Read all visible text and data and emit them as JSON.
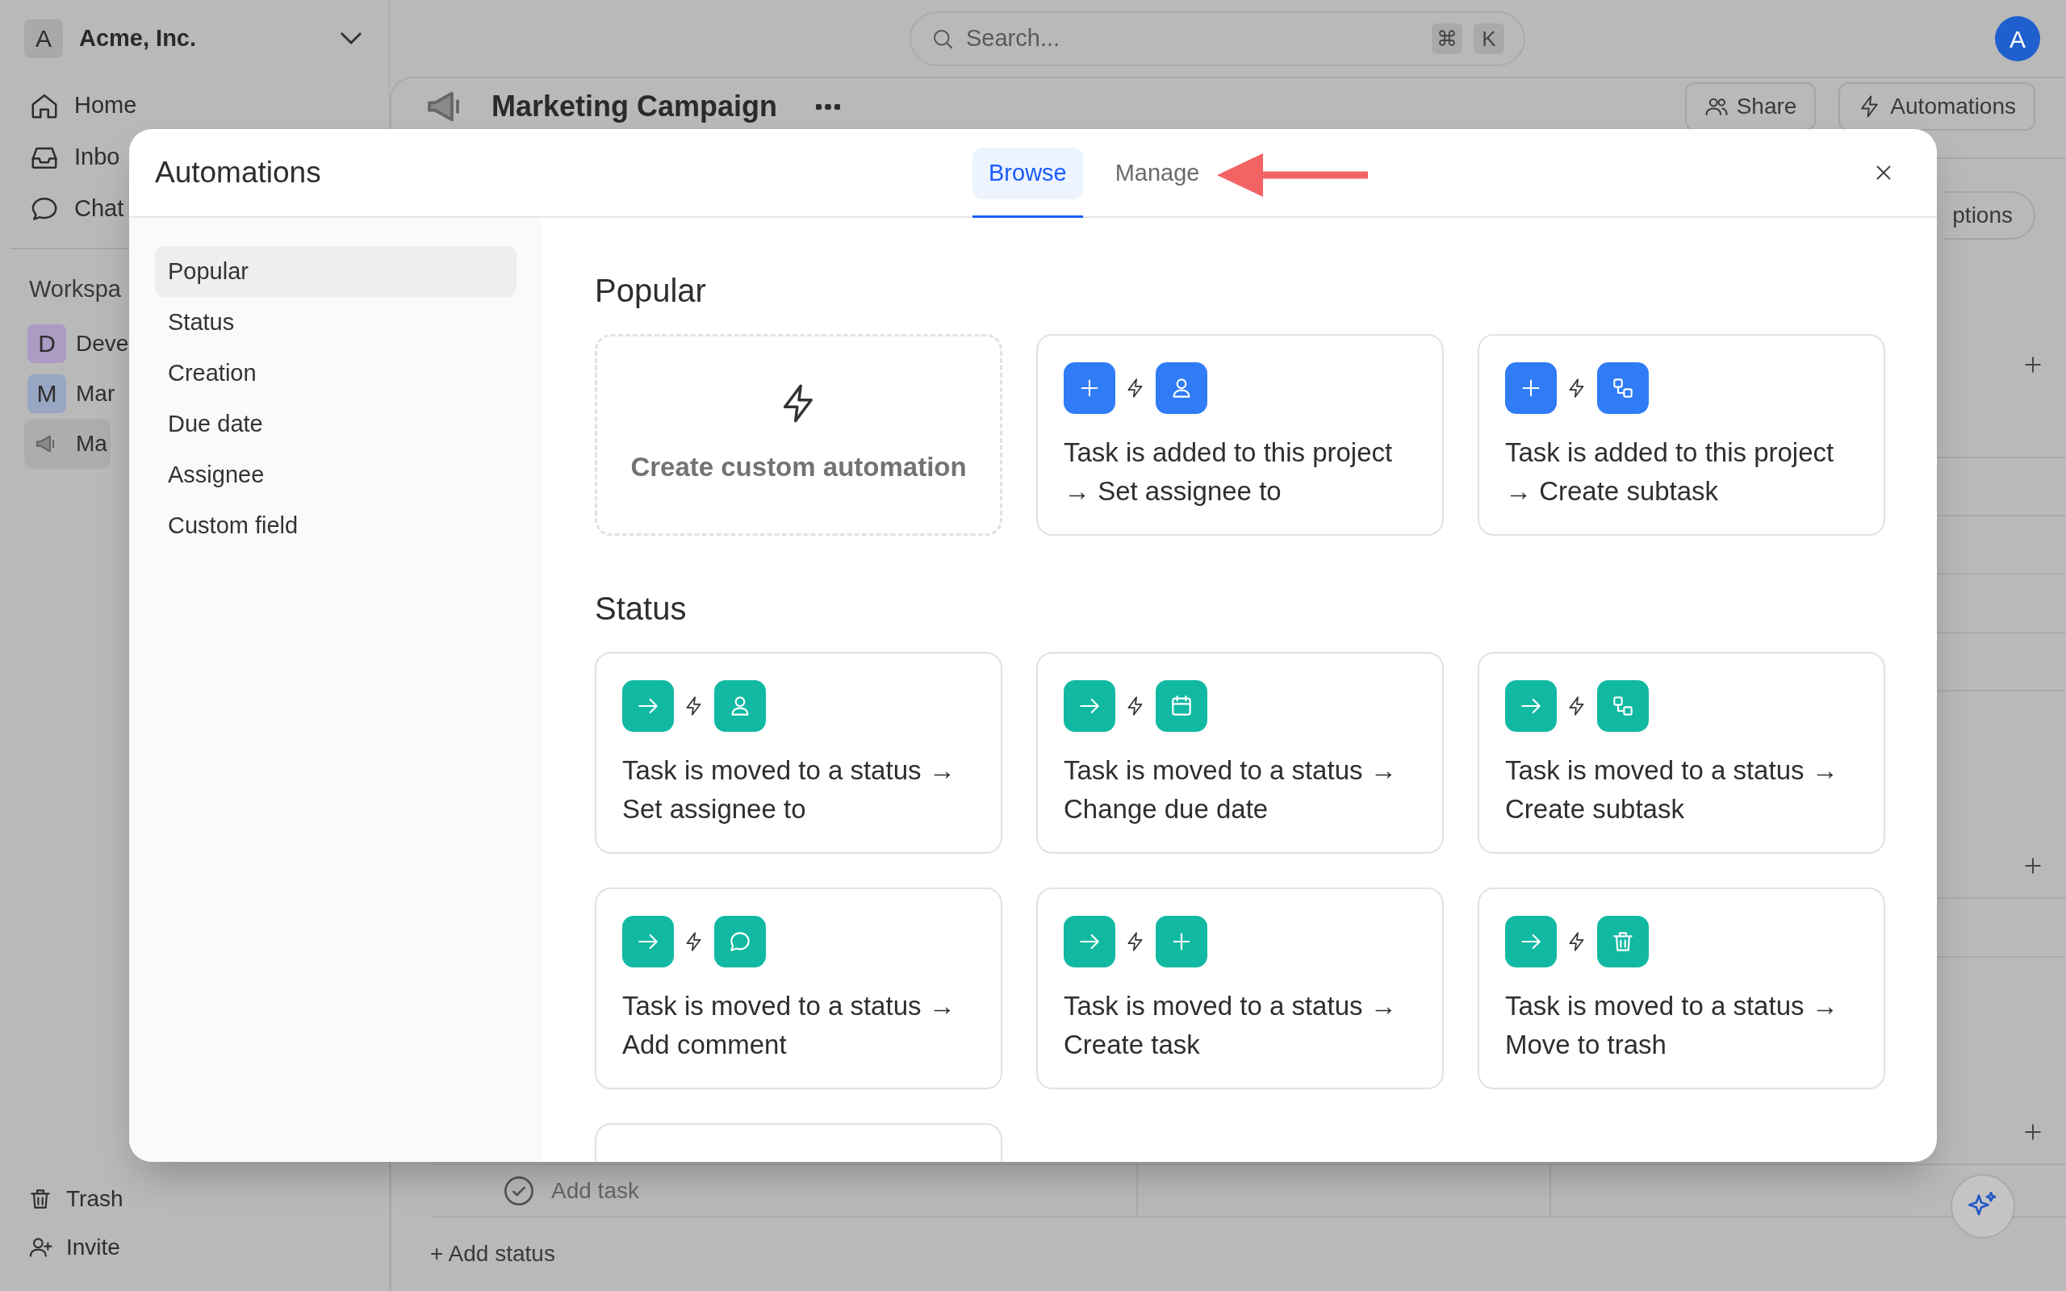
{
  "topbar": {
    "workspace": {
      "initial": "A",
      "name": "Acme, Inc."
    },
    "search": {
      "placeholder": "Search...",
      "keys": [
        "⌘",
        "K"
      ]
    },
    "avatar": "A"
  },
  "sidebar": {
    "nav": [
      {
        "label": "Home"
      },
      {
        "label": "Inbo"
      },
      {
        "label": "Chat"
      }
    ],
    "section": "Workspa",
    "workspaces": [
      {
        "kind": "space",
        "initial": "D",
        "label": "Deve",
        "color": "#ab9cc4",
        "selected": false
      },
      {
        "kind": "space",
        "initial": "M",
        "label": "Mar",
        "color": "#97a6c2",
        "selected": false
      },
      {
        "kind": "project",
        "label": "Ma",
        "selected": true
      }
    ],
    "footer": [
      {
        "label": "Trash"
      },
      {
        "label": "Invite"
      }
    ]
  },
  "project": {
    "title": "Marketing Campaign",
    "actions": [
      {
        "label": "Share"
      },
      {
        "label": "Automations"
      }
    ],
    "options": "ptions"
  },
  "board": {
    "add_task": "Add task",
    "add_status": "+ Add status"
  },
  "modal": {
    "title": "Automations",
    "tabs": [
      {
        "label": "Browse",
        "selected": true
      },
      {
        "label": "Manage",
        "selected": false
      }
    ],
    "categories": [
      {
        "label": "Popular",
        "selected": true
      },
      {
        "label": "Status",
        "selected": false
      },
      {
        "label": "Creation",
        "selected": false
      },
      {
        "label": "Due date",
        "selected": false
      },
      {
        "label": "Assignee",
        "selected": false
      },
      {
        "label": "Custom field",
        "selected": false
      }
    ],
    "sections": [
      {
        "title": "Popular",
        "cards": [
          {
            "kind": "custom",
            "label": "Create custom automation"
          },
          {
            "kind": "rule",
            "chips": [
              {
                "kind": "plus",
                "color": "#2f7cf6"
              },
              {
                "kind": "person",
                "color": "#2f7cf6"
              }
            ],
            "trigger_text": "Task is added to this project",
            "action_text": "→ Set assignee to"
          },
          {
            "kind": "rule",
            "chips": [
              {
                "kind": "plus",
                "color": "#2f7cf6"
              },
              {
                "kind": "subtask",
                "color": "#2f7cf6"
              }
            ],
            "trigger_text": "Task is added to this project",
            "action_text": "→ Create subtask"
          }
        ]
      },
      {
        "title": "Status",
        "cards": [
          {
            "kind": "rule",
            "chips": [
              {
                "kind": "arrow",
                "color": "#12b9a2"
              },
              {
                "kind": "person",
                "color": "#12b9a2"
              }
            ],
            "trigger_text": "Task is moved to a status →",
            "action_text": "Set assignee to"
          },
          {
            "kind": "rule",
            "chips": [
              {
                "kind": "arrow",
                "color": "#12b9a2"
              },
              {
                "kind": "calendar",
                "color": "#12b9a2"
              }
            ],
            "trigger_text": "Task is moved to a status →",
            "action_text": "Change due date"
          },
          {
            "kind": "rule",
            "chips": [
              {
                "kind": "arrow",
                "color": "#12b9a2"
              },
              {
                "kind": "subtask",
                "color": "#12b9a2"
              }
            ],
            "trigger_text": "Task is moved to a status →",
            "action_text": "Create subtask"
          },
          {
            "kind": "rule",
            "chips": [
              {
                "kind": "arrow",
                "color": "#12b9a2"
              },
              {
                "kind": "comment",
                "color": "#12b9a2"
              }
            ],
            "trigger_text": "Task is moved to a status →",
            "action_text": "Add comment"
          },
          {
            "kind": "rule",
            "chips": [
              {
                "kind": "arrow",
                "color": "#12b9a2"
              },
              {
                "kind": "plus",
                "color": "#12b9a2"
              }
            ],
            "trigger_text": "Task is moved to a status →",
            "action_text": "Create task"
          },
          {
            "kind": "rule",
            "chips": [
              {
                "kind": "arrow",
                "color": "#12b9a2"
              },
              {
                "kind": "trash",
                "color": "#12b9a2"
              }
            ],
            "trigger_text": "Task is moved to a status →",
            "action_text": "Move to trash"
          }
        ]
      }
    ]
  }
}
